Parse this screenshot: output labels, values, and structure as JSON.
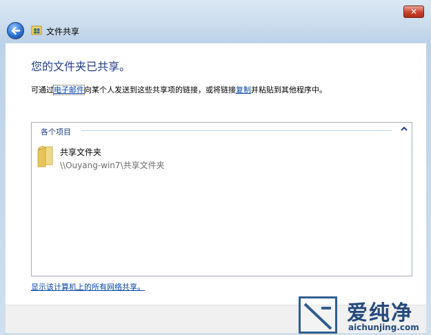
{
  "window": {
    "title": "文件共享",
    "close_label": "✕"
  },
  "content": {
    "heading": "您的文件夹已共享。",
    "desc_prefix": "可通过",
    "email_link": "电子邮件",
    "desc_middle": "向某个人发送到这些共享项的链接，或将链接",
    "copy_link": "复制",
    "desc_suffix": "并粘贴到其他程序中。"
  },
  "group": {
    "header": "各个项目",
    "items": [
      {
        "name": "共享文件夹",
        "path": "\\\\Ouyang-win7\\共享文件夹"
      }
    ]
  },
  "show_all_link": "显示该计算机上的所有网络共享。",
  "watermark": {
    "brand": "爱纯净",
    "url": "aichunjing.com"
  },
  "icons": {
    "back": "back-arrow-icon",
    "close": "close-icon",
    "title": "sharing-wizard-icon",
    "collapse": "chevron-up-icon",
    "folder": "folder-icon"
  },
  "colors": {
    "heading": "#1e3c8c",
    "link": "#0645ad",
    "close_button": "#c8412b"
  }
}
